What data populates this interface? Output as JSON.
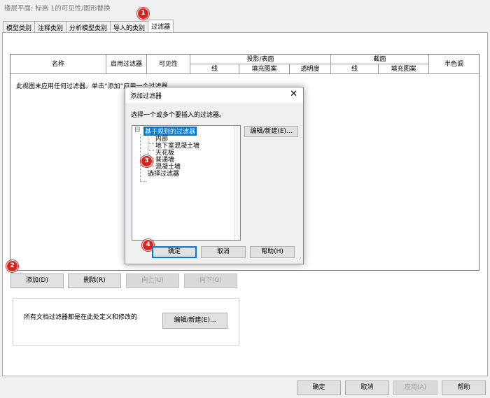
{
  "window": {
    "title": "楼层平面: 标高 1的可见性/图形替换"
  },
  "tabs": [
    {
      "label": "模型类别"
    },
    {
      "label": "注释类别"
    },
    {
      "label": "分析模型类别"
    },
    {
      "label": "导入的类别"
    },
    {
      "label": "过滤器"
    }
  ],
  "grid": {
    "col_name": "名称",
    "col_enable": "启用过滤器",
    "col_visibility": "可见性",
    "group_projection": "投影/表面",
    "group_cut": "截面",
    "col_halftone": "半色调",
    "sub_line": "线",
    "sub_fill": "填充图案",
    "sub_transparency": "透明度",
    "sub_cut_line": "线",
    "sub_cut_fill": "填充图案",
    "empty_message": "此视图未应用任何过滤器。单击“添加”应用一个过滤器。"
  },
  "buttons": {
    "add": "添加(D)",
    "delete": "删除(R)",
    "up": "向上(U)",
    "down": "向下(O)",
    "edit_new": "编辑/新建(E)...",
    "ok": "确定",
    "cancel": "取消",
    "apply": "应用(A)",
    "help": "帮助"
  },
  "group_note": "所有文档过滤器都是在此处定义和修改的",
  "dialog": {
    "title": "添加过滤器",
    "prompt": "选择一个或多个要插入的过滤器。",
    "edit_new": "编辑/新建(E)...",
    "ok": "确定",
    "cancel": "取消",
    "help": "帮助(H)",
    "tree": {
      "root": "基于规则的过滤器",
      "collapse_glyph": "⊟",
      "children": [
        "内部",
        "地下室混凝土墙",
        "天花板",
        "普通墙",
        "混凝土墙"
      ],
      "select_filter": "选择过滤器"
    }
  },
  "badges": [
    "1",
    "2",
    "3",
    "4"
  ],
  "colors": {
    "badge": "#d8231f",
    "selection": "#0078d7",
    "focus": "#0078d7"
  }
}
